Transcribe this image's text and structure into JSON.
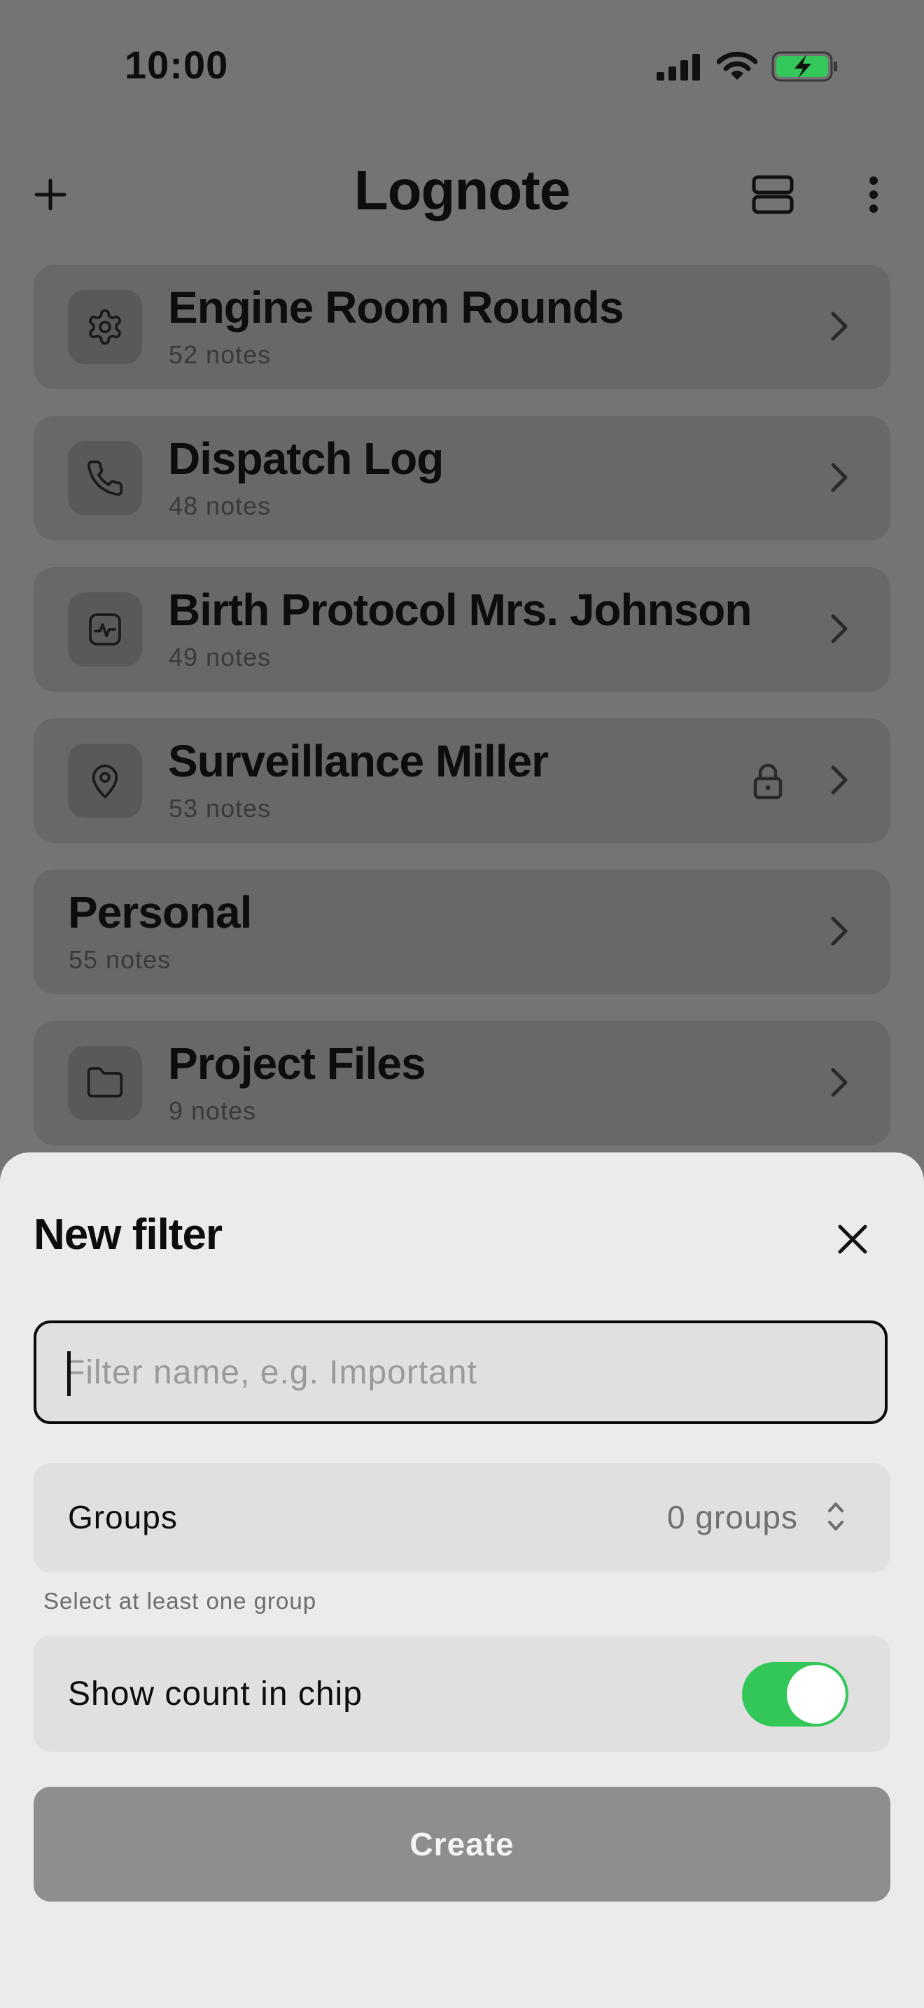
{
  "status_bar": {
    "time": "10:00",
    "icons": [
      "cellular-signal-icon",
      "wifi-icon",
      "battery-charging-icon"
    ]
  },
  "header": {
    "title": "Lognote",
    "add_icon": "plus-icon",
    "layout_icon": "stacked-layout-icon",
    "menu_icon": "more-vertical-icon"
  },
  "groups": [
    {
      "name": "Engine Room Rounds",
      "count": "52 notes",
      "icon": "gear-icon"
    },
    {
      "name": "Dispatch Log",
      "count": "48 notes",
      "icon": "phone-icon"
    },
    {
      "name": "Birth Protocol Mrs. Johnson",
      "count": "49 notes",
      "icon": "heartbeat-icon"
    },
    {
      "name": "Surveillance Miller",
      "count": "53 notes",
      "icon": "location-pin-icon",
      "locked": true
    },
    {
      "name": "Personal",
      "count": "55 notes",
      "icon": ""
    },
    {
      "name": "Project Files",
      "count": "9 notes",
      "icon": "folder-icon"
    }
  ],
  "sheet": {
    "title": "New filter",
    "name_field": {
      "placeholder": "Filter name, e.g. Important",
      "value": ""
    },
    "groups": {
      "label": "Groups",
      "value": "0 groups"
    },
    "helper": "Select at least one group",
    "show_count": {
      "label": "Show count in chip",
      "on": true
    },
    "create_label": "Create"
  },
  "colors": {
    "toggle_on": "#33c759",
    "battery_fill": "#34c759",
    "scrim": "#747474"
  }
}
